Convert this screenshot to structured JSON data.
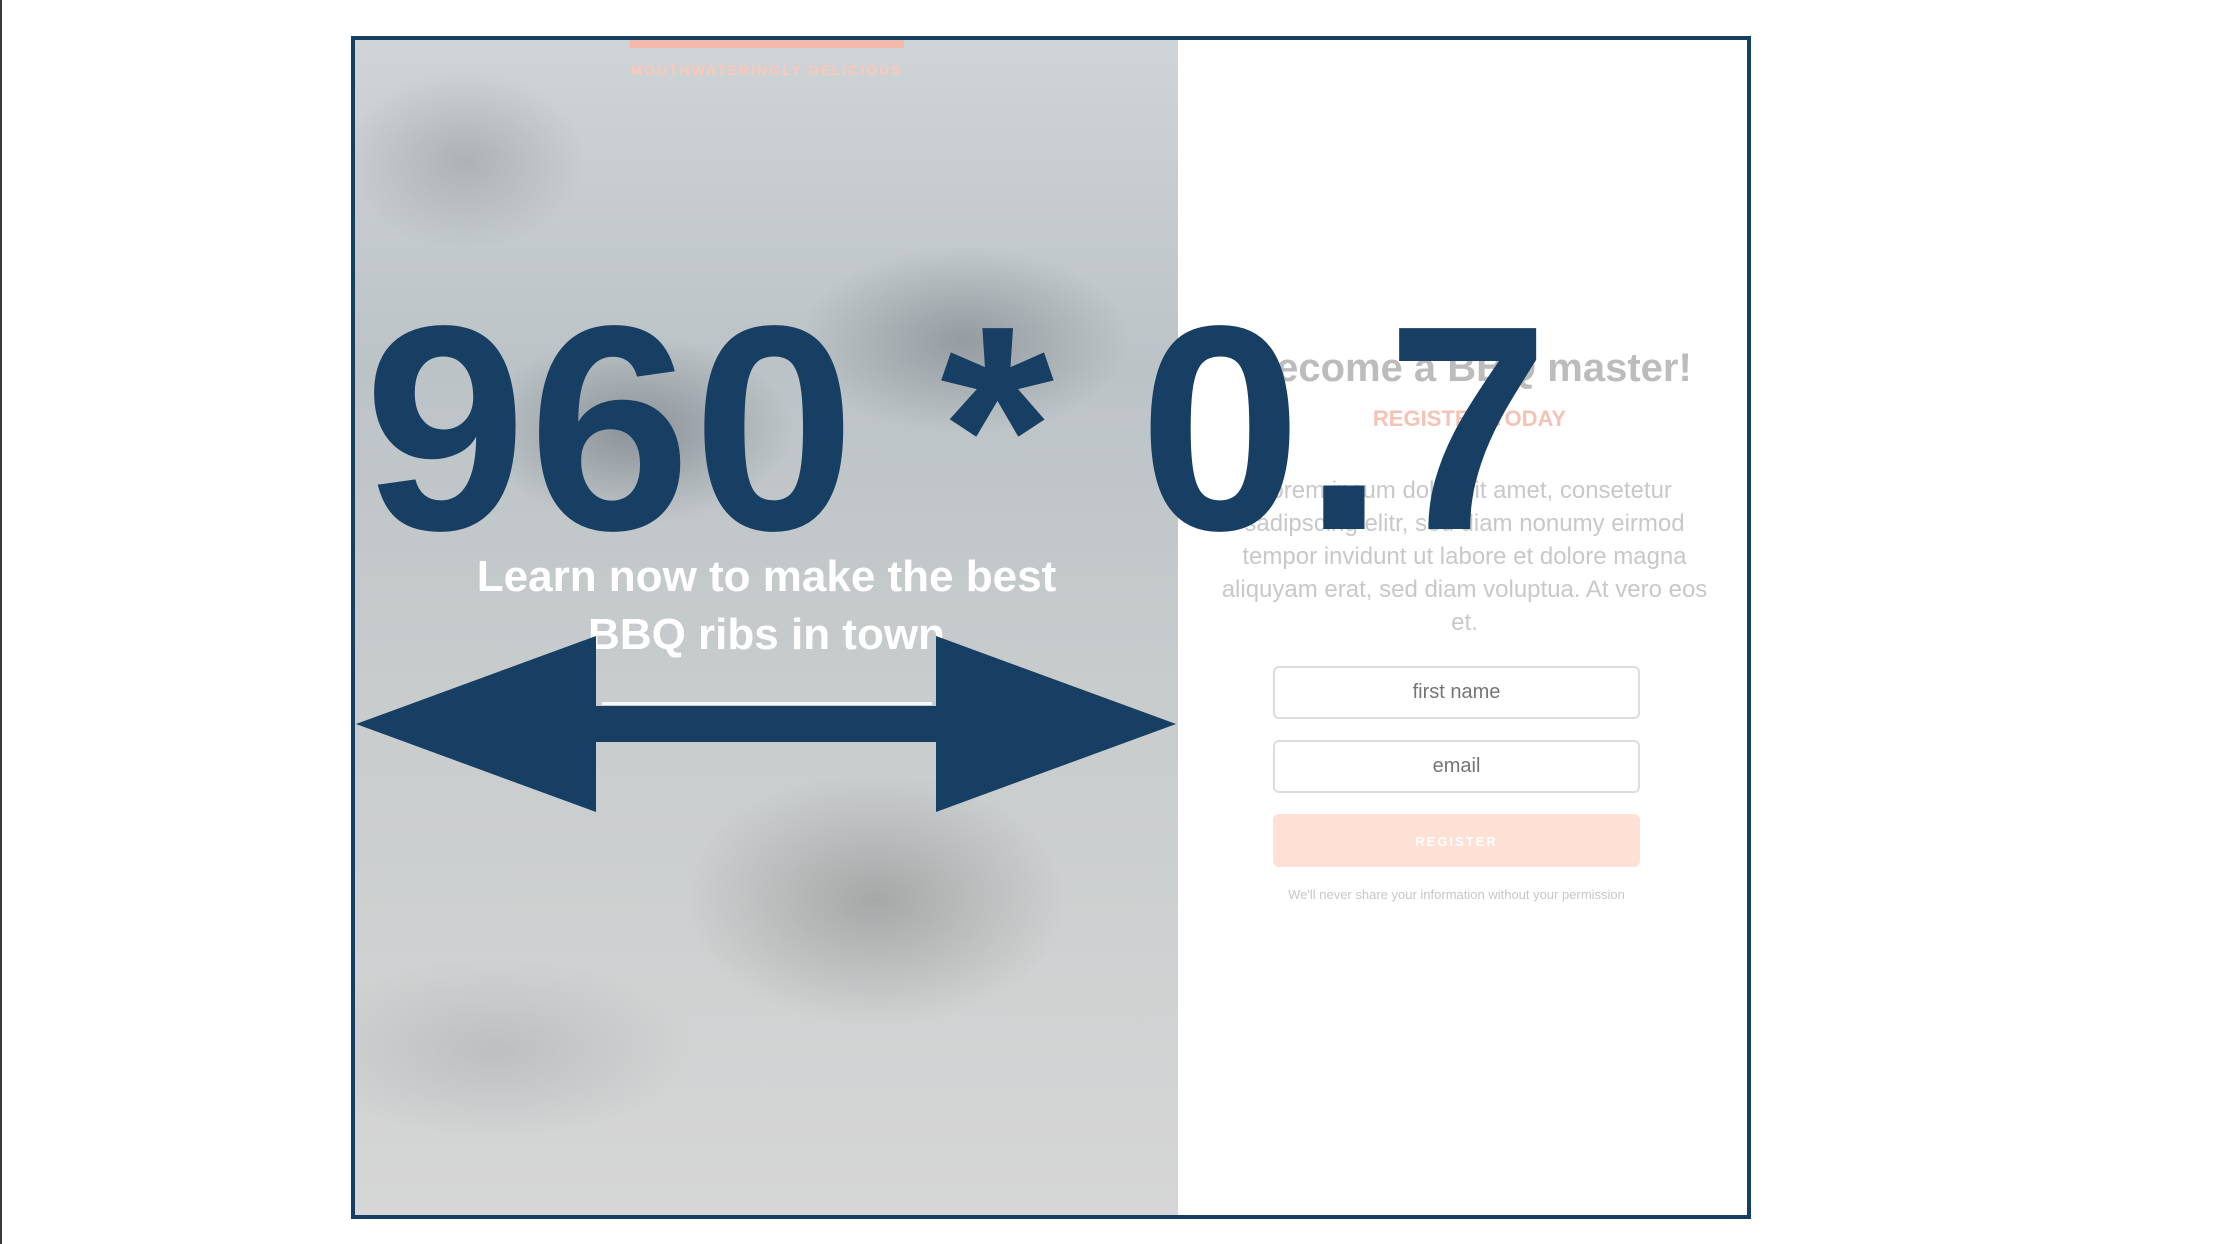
{
  "annotation": {
    "multiplier_label": "960 * 0.7",
    "color": "#173f63"
  },
  "hero": {
    "kicker": "MOUTHWATERINGLY DELICIOUS",
    "heading": "Learn now to make the best BBQ ribs in town"
  },
  "signup": {
    "title": "Become a BBQ master!",
    "subtitle": "REGISTER TODAY",
    "body": "Lorem ipsum dolor sit amet, consetetur sadipscing elitr, sed diam nonumy eirmod tempor invidunt ut labore et dolore magna aliquyam erat, sed diam voluptua. At vero eos et.",
    "first_name_placeholder": "first name",
    "email_placeholder": "email",
    "register_label": "REGISTER",
    "privacy_note": "We'll never share your information without your permission"
  },
  "colors": {
    "frame": "#173f63",
    "accent": "#f4b8a8",
    "button": "#ffe0d5"
  },
  "icons": {
    "width_arrow": "double-headed-horizontal-arrow-icon"
  }
}
